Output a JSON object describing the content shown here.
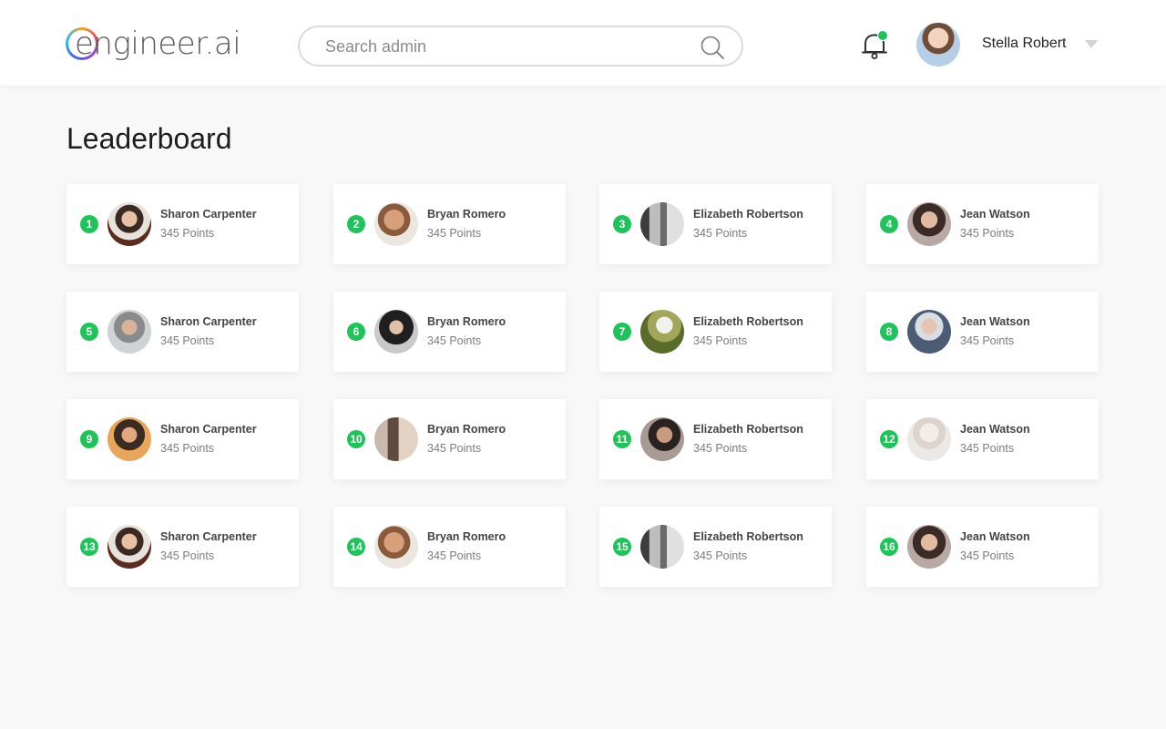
{
  "header": {
    "logo_text": "engineer.ai",
    "search_placeholder": "Search admin",
    "user_name": "Stella Robert",
    "notification_badge_color": "#1ec45a"
  },
  "page": {
    "title": "Leaderboard"
  },
  "leaderboard": [
    {
      "rank": "1",
      "name": "Sharon Carpenter",
      "points": "345 Points",
      "avatar": "av-a"
    },
    {
      "rank": "2",
      "name": "Bryan Romero",
      "points": "345 Points",
      "avatar": "av-b"
    },
    {
      "rank": "3",
      "name": "Elizabeth Robertson",
      "points": "345 Points",
      "avatar": "av-c"
    },
    {
      "rank": "4",
      "name": "Jean Watson",
      "points": "345 Points",
      "avatar": "av-d"
    },
    {
      "rank": "5",
      "name": "Sharon Carpenter",
      "points": "345 Points",
      "avatar": "av-e"
    },
    {
      "rank": "6",
      "name": "Bryan Romero",
      "points": "345 Points",
      "avatar": "av-f"
    },
    {
      "rank": "7",
      "name": "Elizabeth Robertson",
      "points": "345 Points",
      "avatar": "av-g"
    },
    {
      "rank": "8",
      "name": "Jean Watson",
      "points": "345 Points",
      "avatar": "av-h"
    },
    {
      "rank": "9",
      "name": "Sharon Carpenter",
      "points": "345 Points",
      "avatar": "av-i"
    },
    {
      "rank": "10",
      "name": "Bryan Romero",
      "points": "345 Points",
      "avatar": "av-j"
    },
    {
      "rank": "11",
      "name": "Elizabeth Robertson",
      "points": "345 Points",
      "avatar": "av-k"
    },
    {
      "rank": "12",
      "name": "Jean Watson",
      "points": "345 Points",
      "avatar": "av-l"
    },
    {
      "rank": "13",
      "name": "Sharon Carpenter",
      "points": "345 Points",
      "avatar": "av-a"
    },
    {
      "rank": "14",
      "name": "Bryan Romero",
      "points": "345 Points",
      "avatar": "av-b"
    },
    {
      "rank": "15",
      "name": "Elizabeth Robertson",
      "points": "345 Points",
      "avatar": "av-c"
    },
    {
      "rank": "16",
      "name": "Jean Watson",
      "points": "345 Points",
      "avatar": "av-d"
    }
  ],
  "colors": {
    "accent": "#1ec45a",
    "background": "#f8f8f9",
    "card": "#ffffff"
  }
}
